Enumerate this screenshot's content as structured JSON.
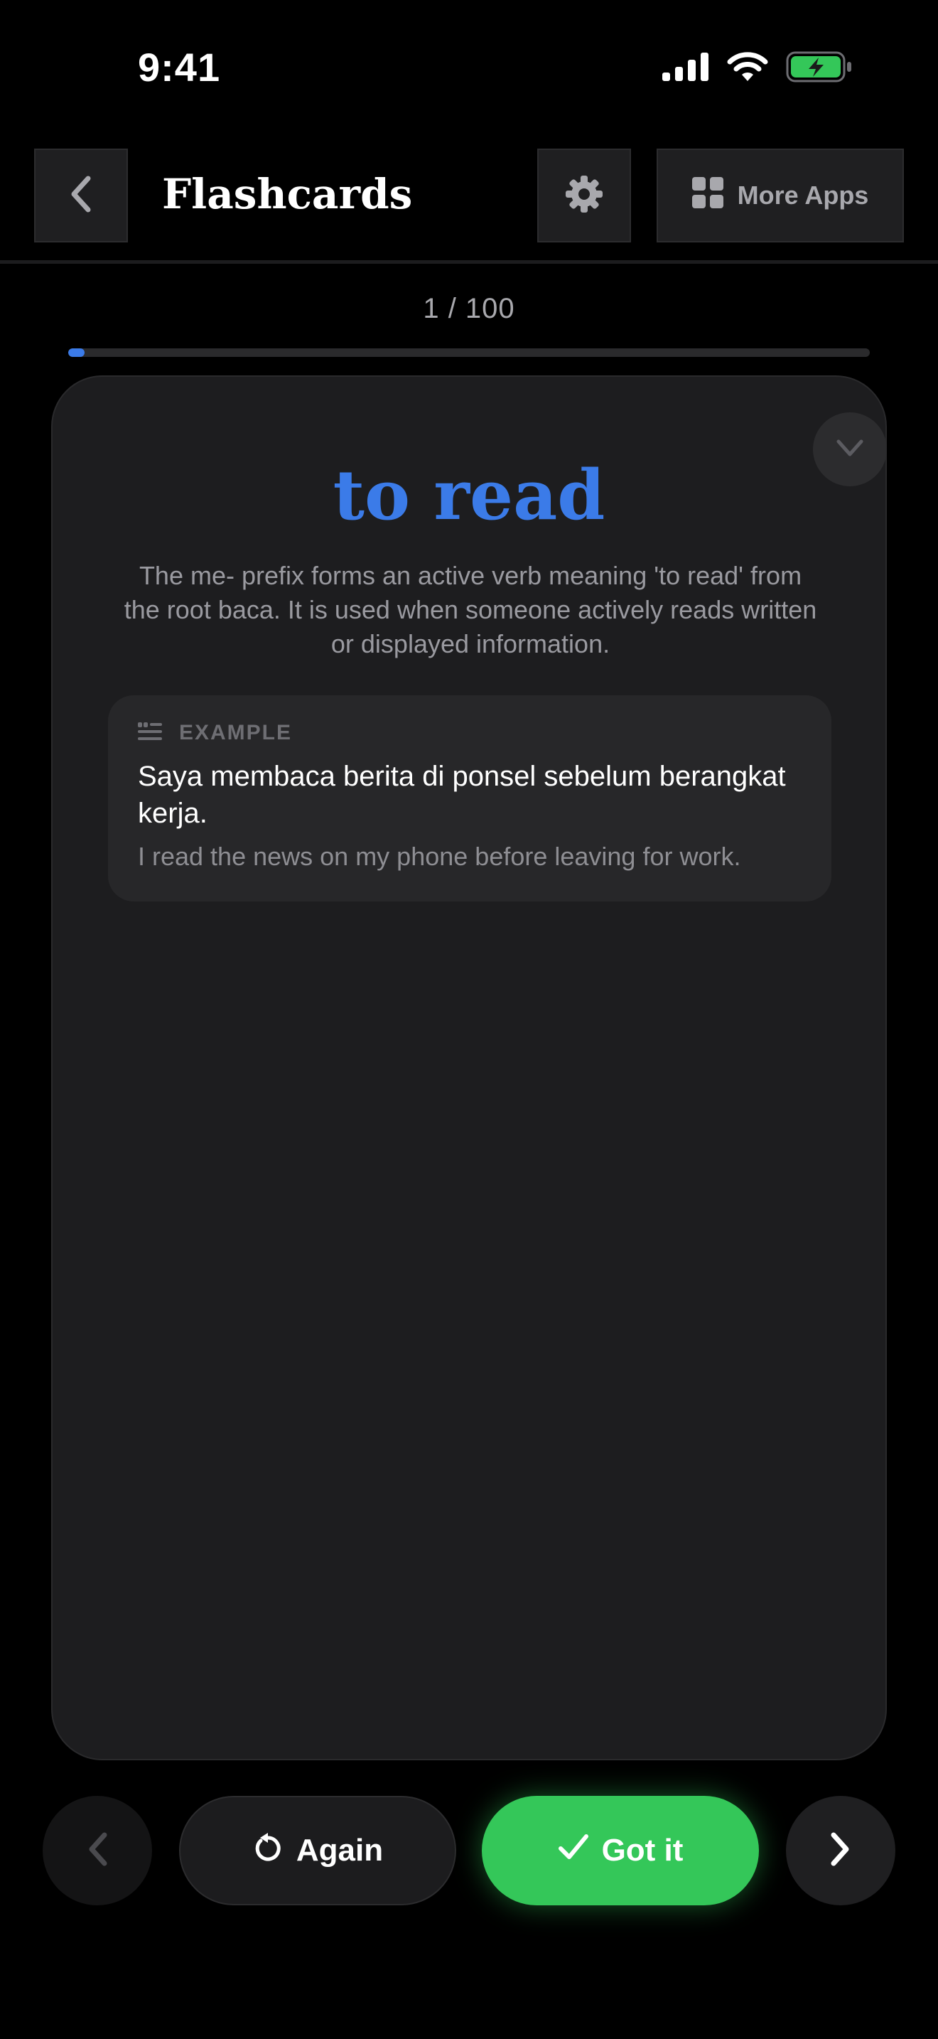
{
  "status_bar": {
    "time": "9:41",
    "icons": [
      "cellular-signal-icon",
      "wifi-icon",
      "battery-charging-icon"
    ]
  },
  "header": {
    "title": "Flashcards",
    "back_icon": "chevron-left-icon",
    "settings_icon": "gear-icon",
    "more_apps_icon": "grid-icon",
    "more_apps_label": "More Apps"
  },
  "progress": {
    "label": "1 / 100",
    "current": 1,
    "total": 100
  },
  "card": {
    "word": "to read",
    "description": "The me- prefix forms an active verb meaning 'to read' from the root baca. It is used when someone actively reads written or displayed information.",
    "collapse_icon": "chevron-down-icon",
    "example": {
      "icon": "quote-list-icon",
      "label": "EXAMPLE",
      "sentence": "Saya membaca berita di ponsel sebelum berangkat kerja.",
      "translation": "I read the news on my phone before leaving for work."
    }
  },
  "actions": {
    "prev_icon": "chevron-left-icon",
    "again_icon": "rotate-ccw-icon",
    "again_label": "Again",
    "got_it_icon": "checkmark-icon",
    "got_it_label": "Got it",
    "next_icon": "chevron-right-icon"
  },
  "colors": {
    "accent_blue": "#3b7be8",
    "success_green": "#34c759",
    "background": "#000000",
    "card_background": "#1d1d1f"
  }
}
